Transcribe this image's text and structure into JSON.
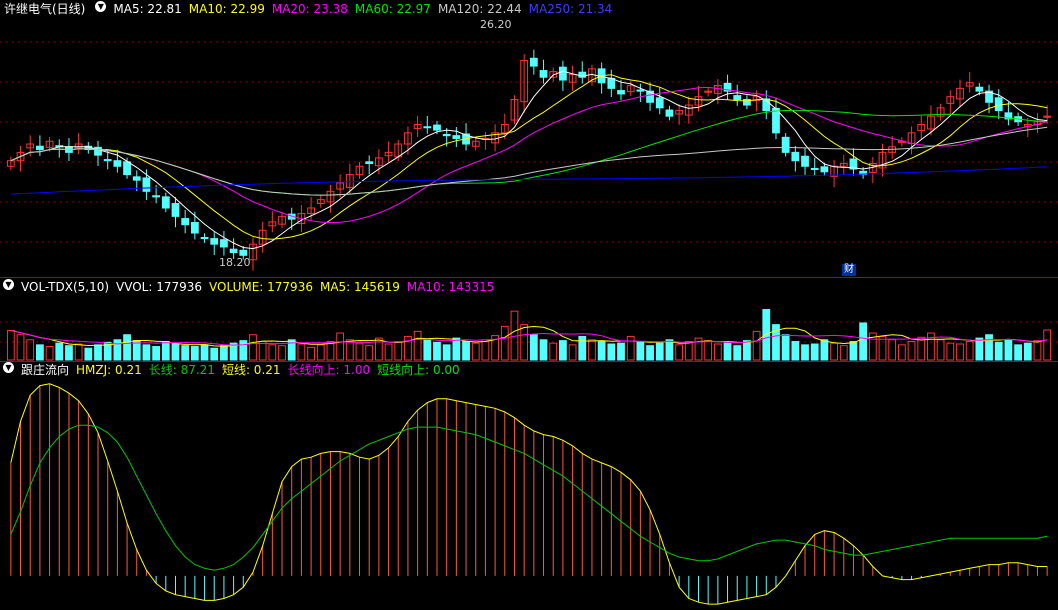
{
  "price_legend": {
    "stock_name": "许继电气(日线)",
    "ma5": "MA5: 22.81",
    "ma10": "MA10: 22.99",
    "ma20": "MA20: 23.38",
    "ma60": "MA60: 22.97",
    "ma120": "MA120: 22.44",
    "ma250": "MA250: 21.34"
  },
  "price_annotations": {
    "high": "26.20",
    "low": "18.20",
    "fin_marker": "财"
  },
  "volume_legend": {
    "name": "VOL-TDX(5,10)",
    "vvol": "VVOL: 177936",
    "volume": "VOLUME: 177936",
    "ma5": "MA5: 145619",
    "ma10": "MA10: 143315"
  },
  "indicator_legend": {
    "name": "跟庄流向",
    "hmzj": "HMZJ: 0.21",
    "long_line": "长线: 87.21",
    "short_line": "短线: 0.21",
    "long_up": "长线向上: 1.00",
    "short_up": "短线向上: 0.00"
  },
  "colors": {
    "up": "#ff3232",
    "down": "#54ffff",
    "ma5": "#ffffff",
    "ma10": "#ffff00",
    "ma20": "#ff00ff",
    "ma60": "#00e600",
    "ma120": "#c8c8c8",
    "ma250": "#0000ff",
    "separator": "#b40000",
    "grid": "#8b0000"
  },
  "chart_data": {
    "type": "candlestick",
    "price_range": [
      17.6,
      26.8
    ],
    "closes": [
      21.6,
      21.9,
      22.2,
      22.0,
      22.3,
      22.1,
      21.9,
      22.2,
      22.0,
      21.8,
      21.6,
      21.4,
      21.1,
      20.9,
      20.5,
      20.3,
      19.9,
      19.6,
      19.3,
      19.0,
      18.8,
      18.6,
      18.5,
      18.3,
      18.2,
      18.6,
      19.1,
      19.4,
      19.6,
      19.5,
      19.7,
      19.9,
      20.2,
      20.5,
      20.8,
      21.1,
      21.4,
      21.5,
      21.7,
      21.9,
      22.2,
      22.6,
      22.9,
      22.8,
      22.7,
      22.5,
      22.4,
      22.2,
      22.3,
      22.4,
      22.6,
      22.9,
      23.8,
      25.2,
      25.0,
      24.6,
      24.8,
      24.5,
      24.7,
      24.6,
      24.9,
      24.4,
      24.2,
      24.0,
      24.3,
      24.1,
      23.7,
      23.5,
      23.2,
      23.4,
      23.6,
      23.9,
      24.1,
      24.3,
      24.1,
      23.8,
      23.6,
      23.9,
      23.4,
      22.6,
      21.9,
      21.6,
      21.4,
      21.3,
      21.2,
      21.4,
      21.5,
      21.3,
      21.1,
      21.5,
      21.9,
      22.1,
      22.3,
      22.6,
      22.9,
      23.2,
      23.5,
      23.9,
      24.2,
      24.4,
      24.1,
      23.7,
      23.4,
      23.1,
      23.0,
      22.9,
      23.0,
      23.2
    ],
    "volume_range": [
      0,
      380000
    ],
    "volumes": [
      175000,
      150000,
      120000,
      90000,
      80000,
      100000,
      85000,
      95000,
      70000,
      90000,
      105000,
      120000,
      150000,
      115000,
      90000,
      80000,
      110000,
      95000,
      85000,
      80000,
      90000,
      70000,
      85000,
      100000,
      115000,
      150000,
      110000,
      90000,
      85000,
      120000,
      95000,
      75000,
      90000,
      110000,
      160000,
      120000,
      100000,
      85000,
      130000,
      95000,
      110000,
      140000,
      170000,
      120000,
      105000,
      90000,
      130000,
      110000,
      100000,
      120000,
      145000,
      200000,
      290000,
      210000,
      150000,
      120000,
      100000,
      115000,
      90000,
      140000,
      120000,
      110000,
      95000,
      100000,
      140000,
      105000,
      85000,
      100000,
      120000,
      90000,
      110000,
      130000,
      115000,
      95000,
      100000,
      85000,
      115000,
      170000,
      300000,
      210000,
      150000,
      110000,
      90000,
      95000,
      120000,
      100000,
      85000,
      110000,
      220000,
      160000,
      140000,
      120000,
      90000,
      110000,
      135000,
      160000,
      120000,
      100000,
      95000,
      110000,
      130000,
      150000,
      105000,
      120000,
      90000,
      100000,
      115000,
      177936
    ],
    "hmzj_range": [
      -16,
      104
    ],
    "hmzj": [
      60,
      82,
      96,
      101,
      102,
      100,
      97,
      93,
      86,
      76,
      61,
      45,
      28,
      14,
      3,
      -4,
      -8,
      -10,
      -11,
      -12,
      -13,
      -13,
      -12,
      -10,
      -6,
      2,
      16,
      33,
      50,
      58,
      62,
      63,
      65,
      66,
      66,
      65,
      63,
      62,
      64,
      68,
      74,
      82,
      88,
      92,
      94,
      94,
      93,
      92,
      91,
      90,
      89,
      87,
      84,
      80,
      77,
      75,
      74,
      72,
      69,
      65,
      62,
      60,
      58,
      55,
      51,
      45,
      35,
      22,
      7,
      -6,
      -12,
      -14,
      -15,
      -15,
      -14,
      -13,
      -12,
      -11,
      -10,
      -6,
      0,
      8,
      16,
      22,
      24,
      23,
      20,
      16,
      11,
      5,
      0,
      -1,
      -2,
      -2,
      -1,
      0,
      1,
      2,
      3,
      4,
      5,
      6,
      6,
      7,
      7,
      6,
      5,
      5
    ],
    "long_line": [
      22,
      34,
      48,
      60,
      68,
      74,
      78,
      80,
      80,
      79,
      76,
      71,
      63,
      53,
      43,
      33,
      24,
      16,
      10,
      6,
      4,
      3,
      4,
      6,
      10,
      15,
      22,
      29,
      36,
      41,
      45,
      49,
      53,
      57,
      61,
      64,
      67,
      70,
      72,
      74,
      76,
      78,
      79,
      79,
      79,
      78,
      77,
      76,
      75,
      73,
      71,
      69,
      67,
      65,
      62,
      59,
      56,
      53,
      49,
      45,
      41,
      37,
      33,
      29,
      25,
      21,
      18,
      15,
      12,
      10,
      9,
      8,
      8,
      9,
      11,
      13,
      15,
      17,
      18,
      19,
      19,
      18,
      17,
      16,
      14,
      13,
      12,
      11,
      11,
      12,
      13,
      14,
      15,
      16,
      17,
      18,
      19,
      20,
      20,
      20,
      20,
      20,
      20,
      20,
      20,
      20,
      20,
      21
    ]
  }
}
